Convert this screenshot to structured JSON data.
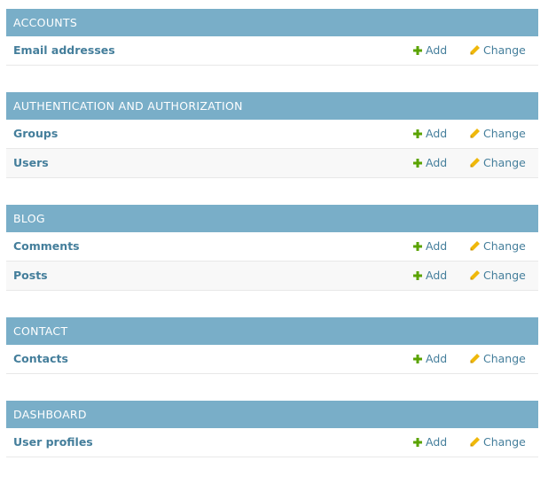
{
  "colors": {
    "header_bg": "#79aec8",
    "link": "#447e9b",
    "add_icon": "#5aa300",
    "change_icon": "#efb80b"
  },
  "add_label": "Add",
  "change_label": "Change",
  "modules": [
    {
      "title": "ACCOUNTS",
      "models": [
        "Email addresses"
      ]
    },
    {
      "title": "AUTHENTICATION AND AUTHORIZATION",
      "models": [
        "Groups",
        "Users"
      ]
    },
    {
      "title": "BLOG",
      "models": [
        "Comments",
        "Posts"
      ]
    },
    {
      "title": "CONTACT",
      "models": [
        "Contacts"
      ]
    },
    {
      "title": "DASHBOARD",
      "models": [
        "User profiles"
      ]
    }
  ]
}
